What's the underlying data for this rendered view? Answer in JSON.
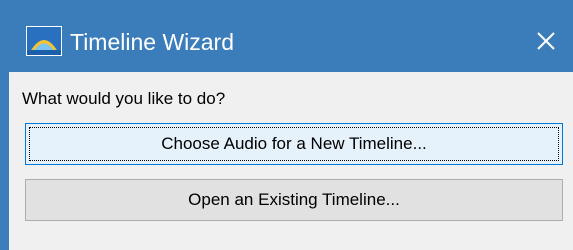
{
  "window": {
    "title": "Timeline Wizard",
    "close_glyph": "✕",
    "icon": "timeline-app-icon"
  },
  "dialog": {
    "prompt": "What would you like to do?",
    "choose_audio_label": "Choose Audio for a New Timeline...",
    "open_existing_label": "Open an Existing Timeline..."
  },
  "colors": {
    "titlebar": "#3b7dbb",
    "client_background": "#f0f0f0",
    "focused_button_background": "#e5f1fb",
    "focused_button_border": "#0078d7",
    "button_background": "#e1e1e1",
    "button_border": "#adadad"
  }
}
